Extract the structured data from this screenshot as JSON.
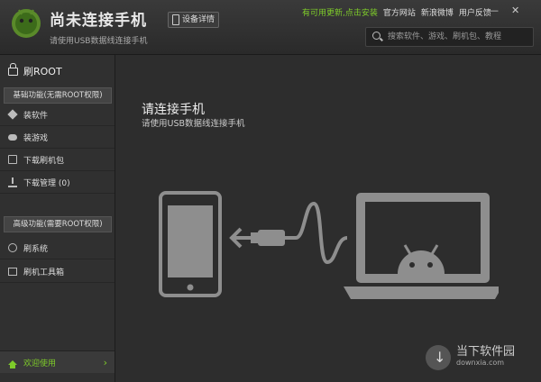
{
  "app": {
    "title": "尚未连接手机",
    "subtitle": "请使用USB数据线连接手机",
    "device_button": "设备详情"
  },
  "top_links": {
    "update": "有可用更新,点击安装",
    "official_site": "官方网站",
    "weibo": "新浪微博",
    "feedback": "用户反馈"
  },
  "window_controls": {
    "minimize": "—",
    "close": "✕"
  },
  "search": {
    "placeholder": "搜索软件、游戏、刷机包、教程"
  },
  "sidebar": {
    "root_label": "刷ROOT",
    "basic_section": "基础功能(无需ROOT权限)",
    "basic_items": [
      {
        "label": "装软件",
        "icon": "cube-icon"
      },
      {
        "label": "装游戏",
        "icon": "gamepad-icon"
      },
      {
        "label": "下载刷机包",
        "icon": "package-icon"
      },
      {
        "label": "下载管理 (0)",
        "icon": "download-icon"
      }
    ],
    "advanced_section": "高级功能(需要ROOT权限)",
    "advanced_items": [
      {
        "label": "刷系统",
        "icon": "system-icon"
      },
      {
        "label": "刷机工具箱",
        "icon": "toolbox-icon"
      }
    ],
    "welcome": "欢迎使用",
    "welcome_arrow": "›"
  },
  "main": {
    "title": "请连接手机",
    "subtitle": "请使用USB数据线连接手机"
  },
  "watermark": {
    "line1": "当下软件园",
    "line2": "downxia.com"
  },
  "colors": {
    "accent_green": "#7ecb2a",
    "background": "#2d2d2d",
    "sidebar": "#303030"
  }
}
